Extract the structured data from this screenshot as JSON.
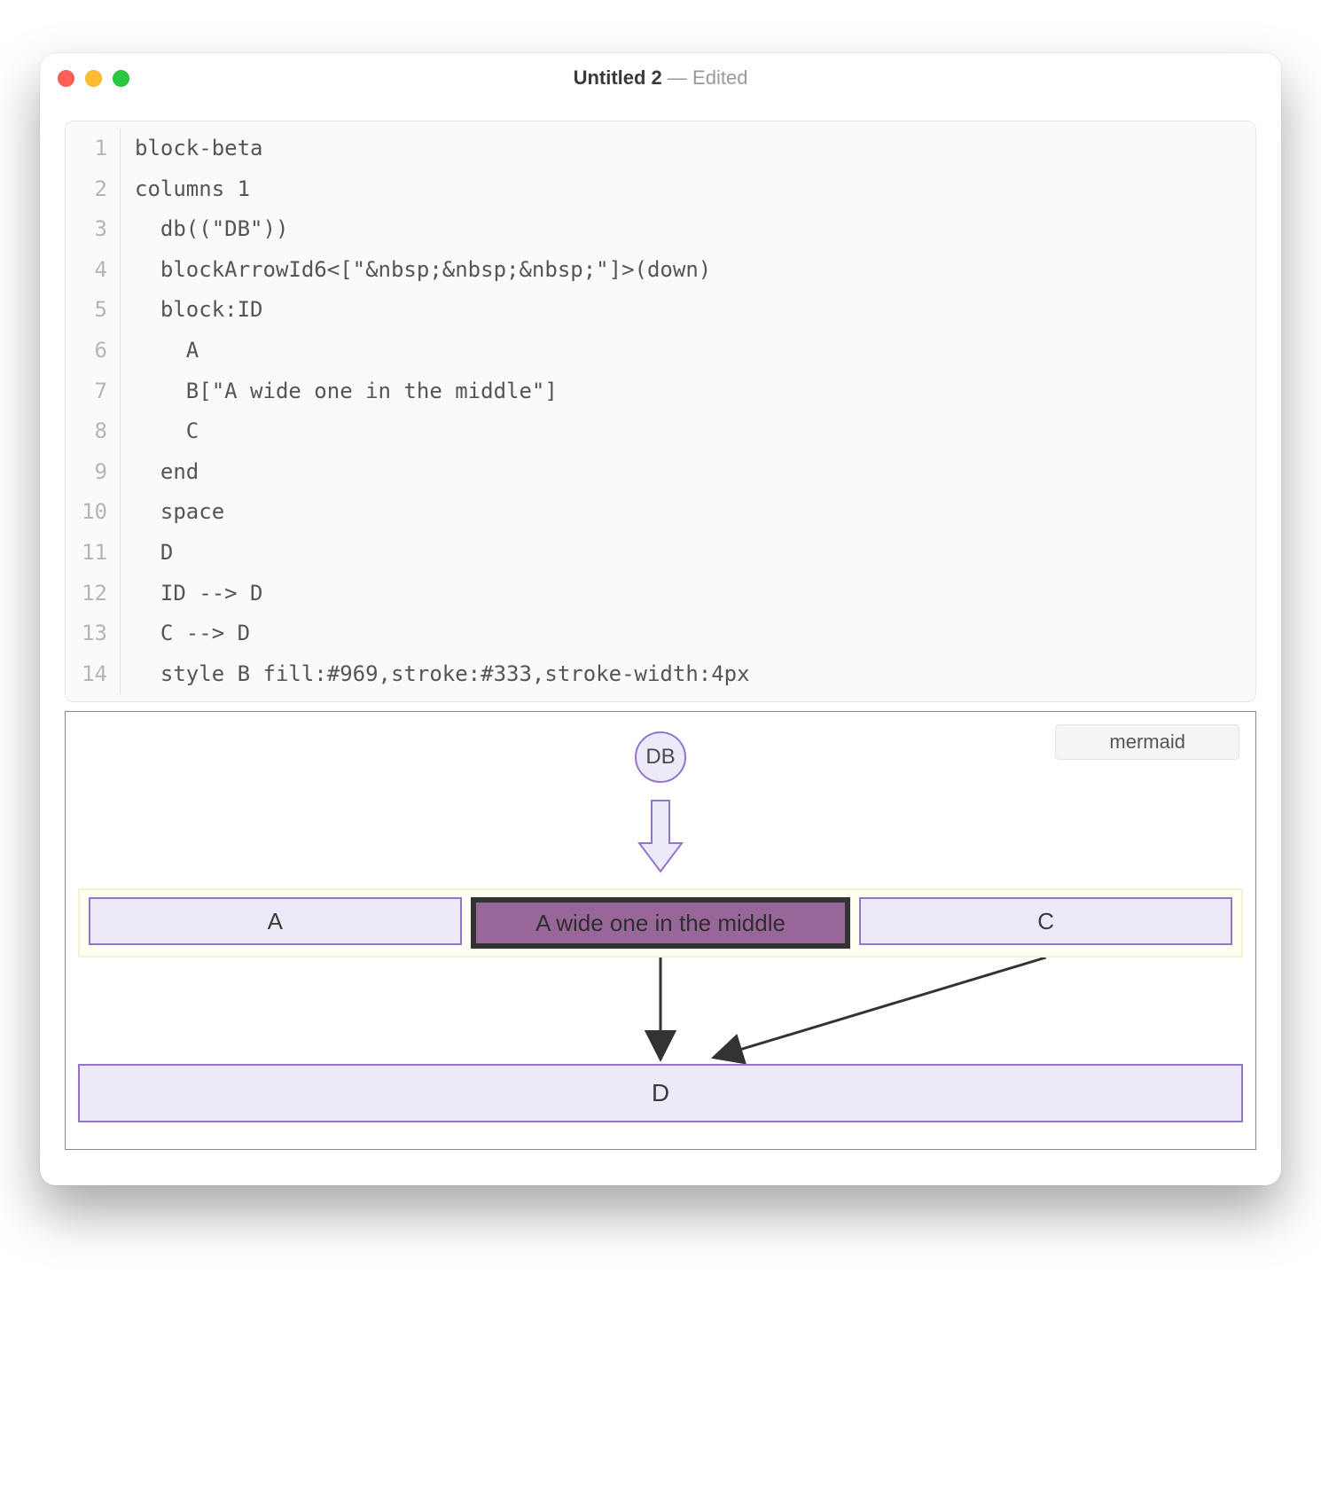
{
  "window": {
    "title": "Untitled 2",
    "status": "Edited"
  },
  "editor": {
    "lines": [
      "block-beta",
      "columns 1",
      "  db((\"DB\"))",
      "  blockArrowId6<[\"&nbsp;&nbsp;&nbsp;\"]>(down)",
      "  block:ID",
      "    A",
      "    B[\"A wide one in the middle\"]",
      "    C",
      "  end",
      "  space",
      "  D",
      "  ID --> D",
      "  C --> D",
      "  style B fill:#969,stroke:#333,stroke-width:4px"
    ]
  },
  "preview": {
    "language_label": "mermaid",
    "nodes": {
      "db": "DB",
      "a": "A",
      "b": "A wide one in the middle",
      "c": "C",
      "d": "D"
    }
  },
  "chart_data": {
    "type": "block-diagram",
    "title": "Mermaid block-beta diagram",
    "columns": 1,
    "nodes": [
      {
        "id": "db",
        "label": "DB",
        "shape": "circle"
      },
      {
        "id": "blockArrowId6",
        "label": "   ",
        "shape": "block-arrow-down"
      },
      {
        "id": "ID",
        "shape": "group",
        "children": [
          {
            "id": "A",
            "label": "A",
            "shape": "rect"
          },
          {
            "id": "B",
            "label": "A wide one in the middle",
            "shape": "rect",
            "style": {
              "fill": "#969",
              "stroke": "#333",
              "stroke-width": "4px"
            }
          },
          {
            "id": "C",
            "label": "C",
            "shape": "rect"
          }
        ]
      },
      {
        "id": "space",
        "shape": "space"
      },
      {
        "id": "D",
        "label": "D",
        "shape": "rect"
      }
    ],
    "edges": [
      {
        "from": "ID",
        "to": "D",
        "type": "arrow"
      },
      {
        "from": "C",
        "to": "D",
        "type": "arrow"
      }
    ]
  }
}
